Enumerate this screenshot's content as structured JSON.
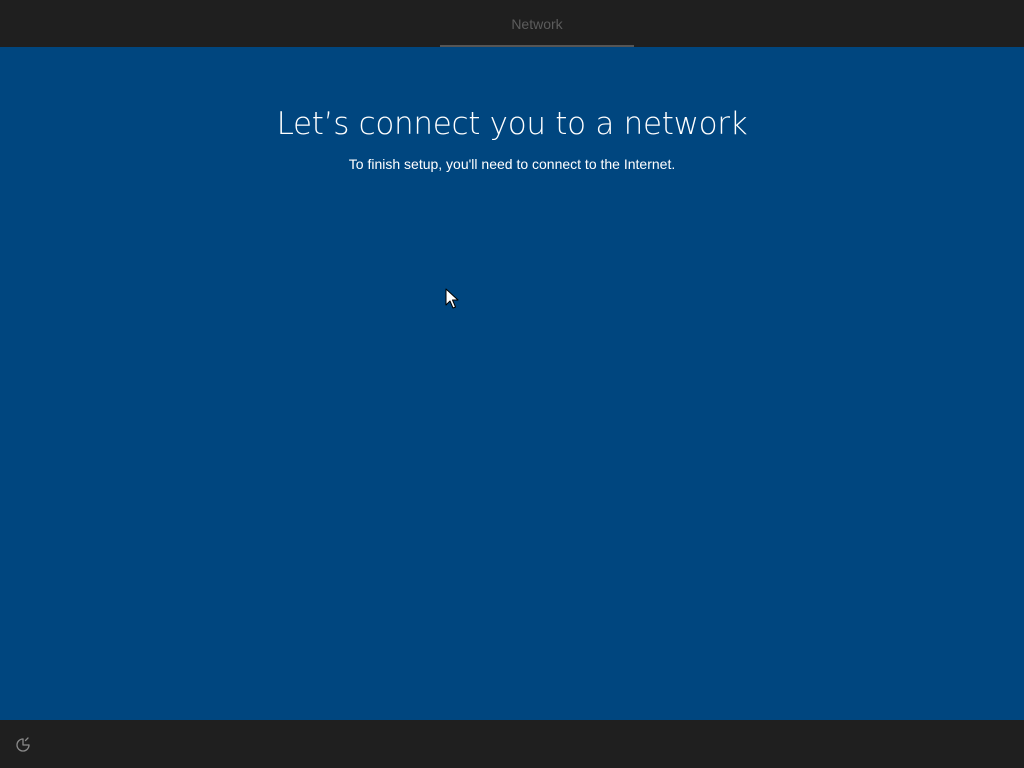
{
  "header": {
    "current_step": "Network"
  },
  "main": {
    "title": "Let’s connect you to a network",
    "subtitle": "To finish setup, you'll need to connect to the Internet."
  },
  "footer": {
    "ease_of_access_icon": "ease-of-access-icon"
  },
  "colors": {
    "background": "#00467f",
    "chrome": "#1f1f1f",
    "tab_underline": "#555555",
    "step_text": "#5c5c5c"
  }
}
